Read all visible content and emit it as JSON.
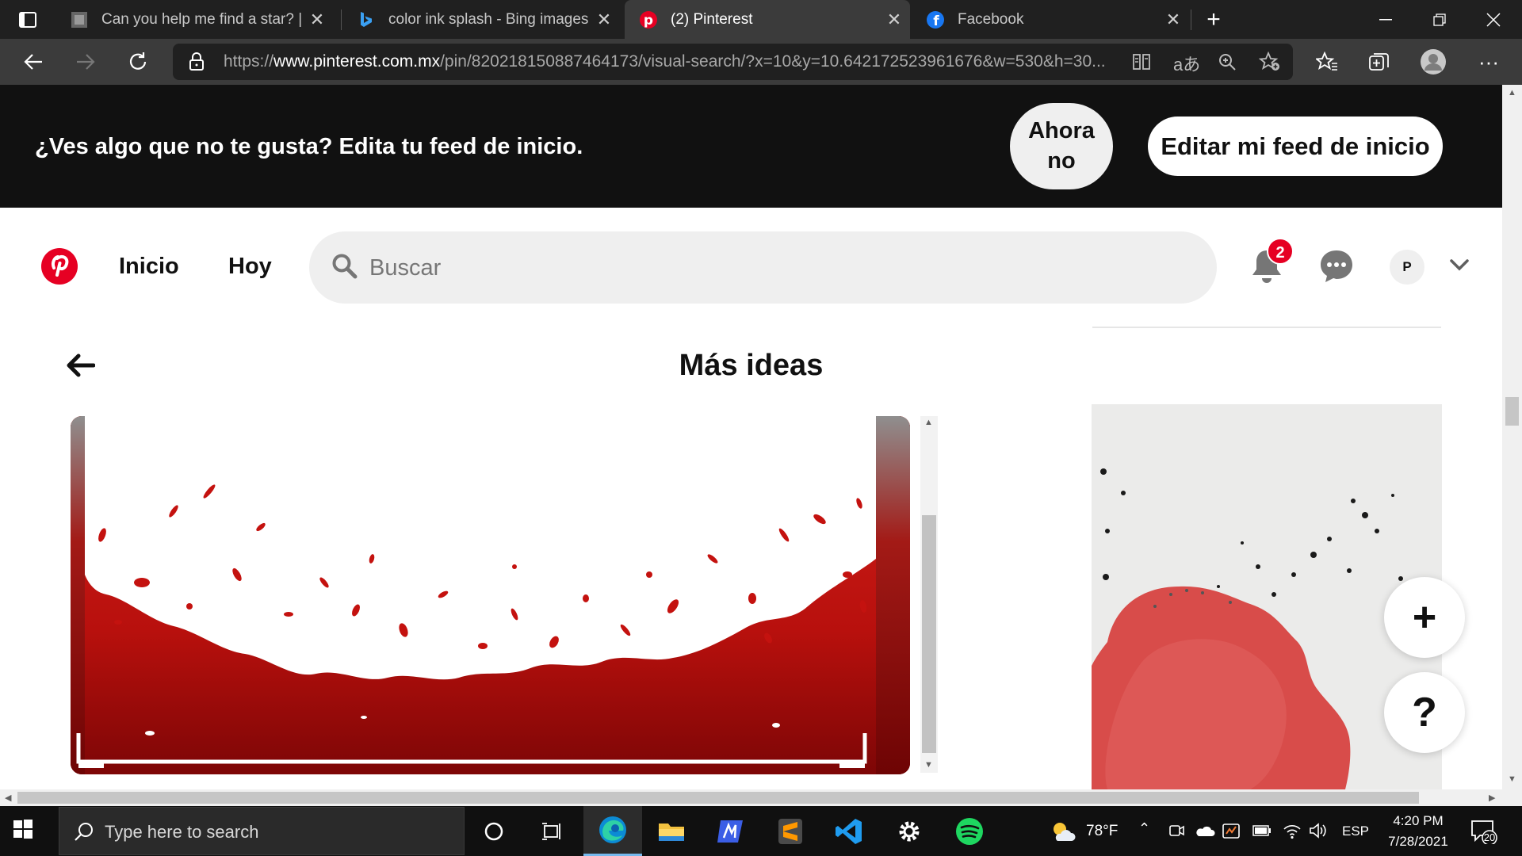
{
  "browser": {
    "tabs": [
      {
        "title": "Can you help me find a star? | Sk",
        "icon": "generic-page-icon"
      },
      {
        "title": "color ink splash - Bing images",
        "icon": "bing-icon"
      },
      {
        "title": "(2) Pinterest",
        "icon": "pinterest-icon",
        "active": true
      },
      {
        "title": "Facebook",
        "icon": "facebook-icon"
      }
    ],
    "url": {
      "scheme": "https://",
      "host": "www.pinterest.com.mx",
      "path": "/pin/820218150887464173/visual-search/?x=10&y=10.642172523961676&w=530&h=30..."
    }
  },
  "banner": {
    "message": "¿Ves algo que no te gusta? Edita tu feed de inicio.",
    "not_now_line1": "Ahora",
    "not_now_line2": "no",
    "edit_feed": "Editar mi feed de inicio"
  },
  "header": {
    "nav": [
      "Inicio",
      "Hoy"
    ],
    "search_placeholder": "Buscar",
    "notification_count": "2",
    "avatar_initial": "P"
  },
  "content": {
    "title": "Más ideas",
    "fab_add": "+",
    "fab_help": "?"
  },
  "taskbar": {
    "search_placeholder": "Type here to search",
    "weather": "78°F",
    "language": "ESP",
    "time": "4:20 PM",
    "date": "7/28/2021",
    "notification_count": "20"
  },
  "colors": {
    "pinterest_red": "#e60023",
    "splash_red": "#c4120f",
    "banner_bg": "#111111"
  }
}
